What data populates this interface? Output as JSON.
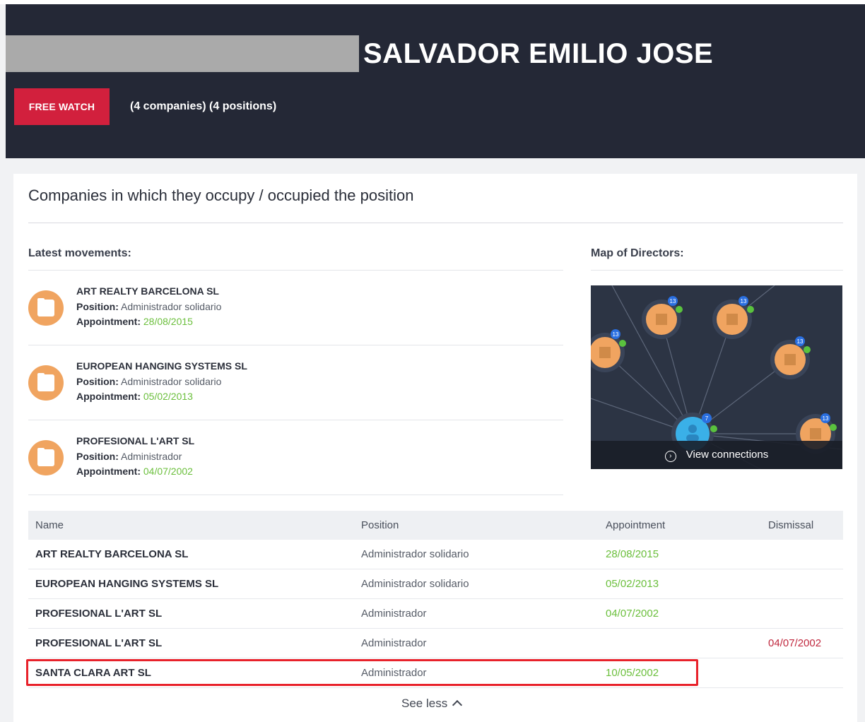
{
  "header": {
    "name": "SALVADOR EMILIO JOSE",
    "watch_button": "FREE WATCH",
    "counts": "(4 companies) (4 positions)"
  },
  "card": {
    "title": "Companies in which they occupy / occupied the position",
    "latest_movements_title": "Latest movements:",
    "map_title": "Map of Directors:",
    "view_connections": "View connections"
  },
  "movements": [
    {
      "company": "ART REALTY BARCELONA SL",
      "position_label": "Position:",
      "position": "Administrador solidario",
      "appointment_label": "Appointment:",
      "appointment": "28/08/2015"
    },
    {
      "company": "EUROPEAN HANGING SYSTEMS SL",
      "position_label": "Position:",
      "position": "Administrador solidario",
      "appointment_label": "Appointment:",
      "appointment": "05/02/2013"
    },
    {
      "company": "PROFESIONAL L'ART SL",
      "position_label": "Position:",
      "position": "Administrador",
      "appointment_label": "Appointment:",
      "appointment": "04/07/2002"
    }
  ],
  "table": {
    "headers": {
      "name": "Name",
      "position": "Position",
      "appointment": "Appointment",
      "dismissal": "Dismissal"
    },
    "rows": [
      {
        "name": "ART REALTY BARCELONA SL",
        "position": "Administrador solidario",
        "appointment": "28/08/2015",
        "dismissal": ""
      },
      {
        "name": "EUROPEAN HANGING SYSTEMS SL",
        "position": "Administrador solidario",
        "appointment": "05/02/2013",
        "dismissal": ""
      },
      {
        "name": "PROFESIONAL L'ART SL",
        "position": "Administrador",
        "appointment": "04/07/2002",
        "dismissal": ""
      },
      {
        "name": "PROFESIONAL L'ART SL",
        "position": "Administrador",
        "appointment": "",
        "dismissal": "04/07/2002"
      },
      {
        "name": "SANTA CLARA ART SL",
        "position": "Administrador",
        "appointment": "10/05/2002",
        "dismissal": ""
      }
    ]
  },
  "see_less": "See less",
  "map_badges": [
    "13",
    "13",
    "13",
    "13",
    "13",
    "7"
  ],
  "colors": {
    "header_bg": "#242836",
    "brand_red": "#d2203d",
    "appointment_green": "#6bbf3c",
    "dismissal_red": "#c0293f",
    "company_node": "#f0a460",
    "person_node": "#3ab0e8",
    "highlight": "#e8222b"
  },
  "icons": {
    "movement": "building-icon",
    "view_connections": "chevron-circle-right-icon",
    "see_less": "chevron-up-icon"
  }
}
